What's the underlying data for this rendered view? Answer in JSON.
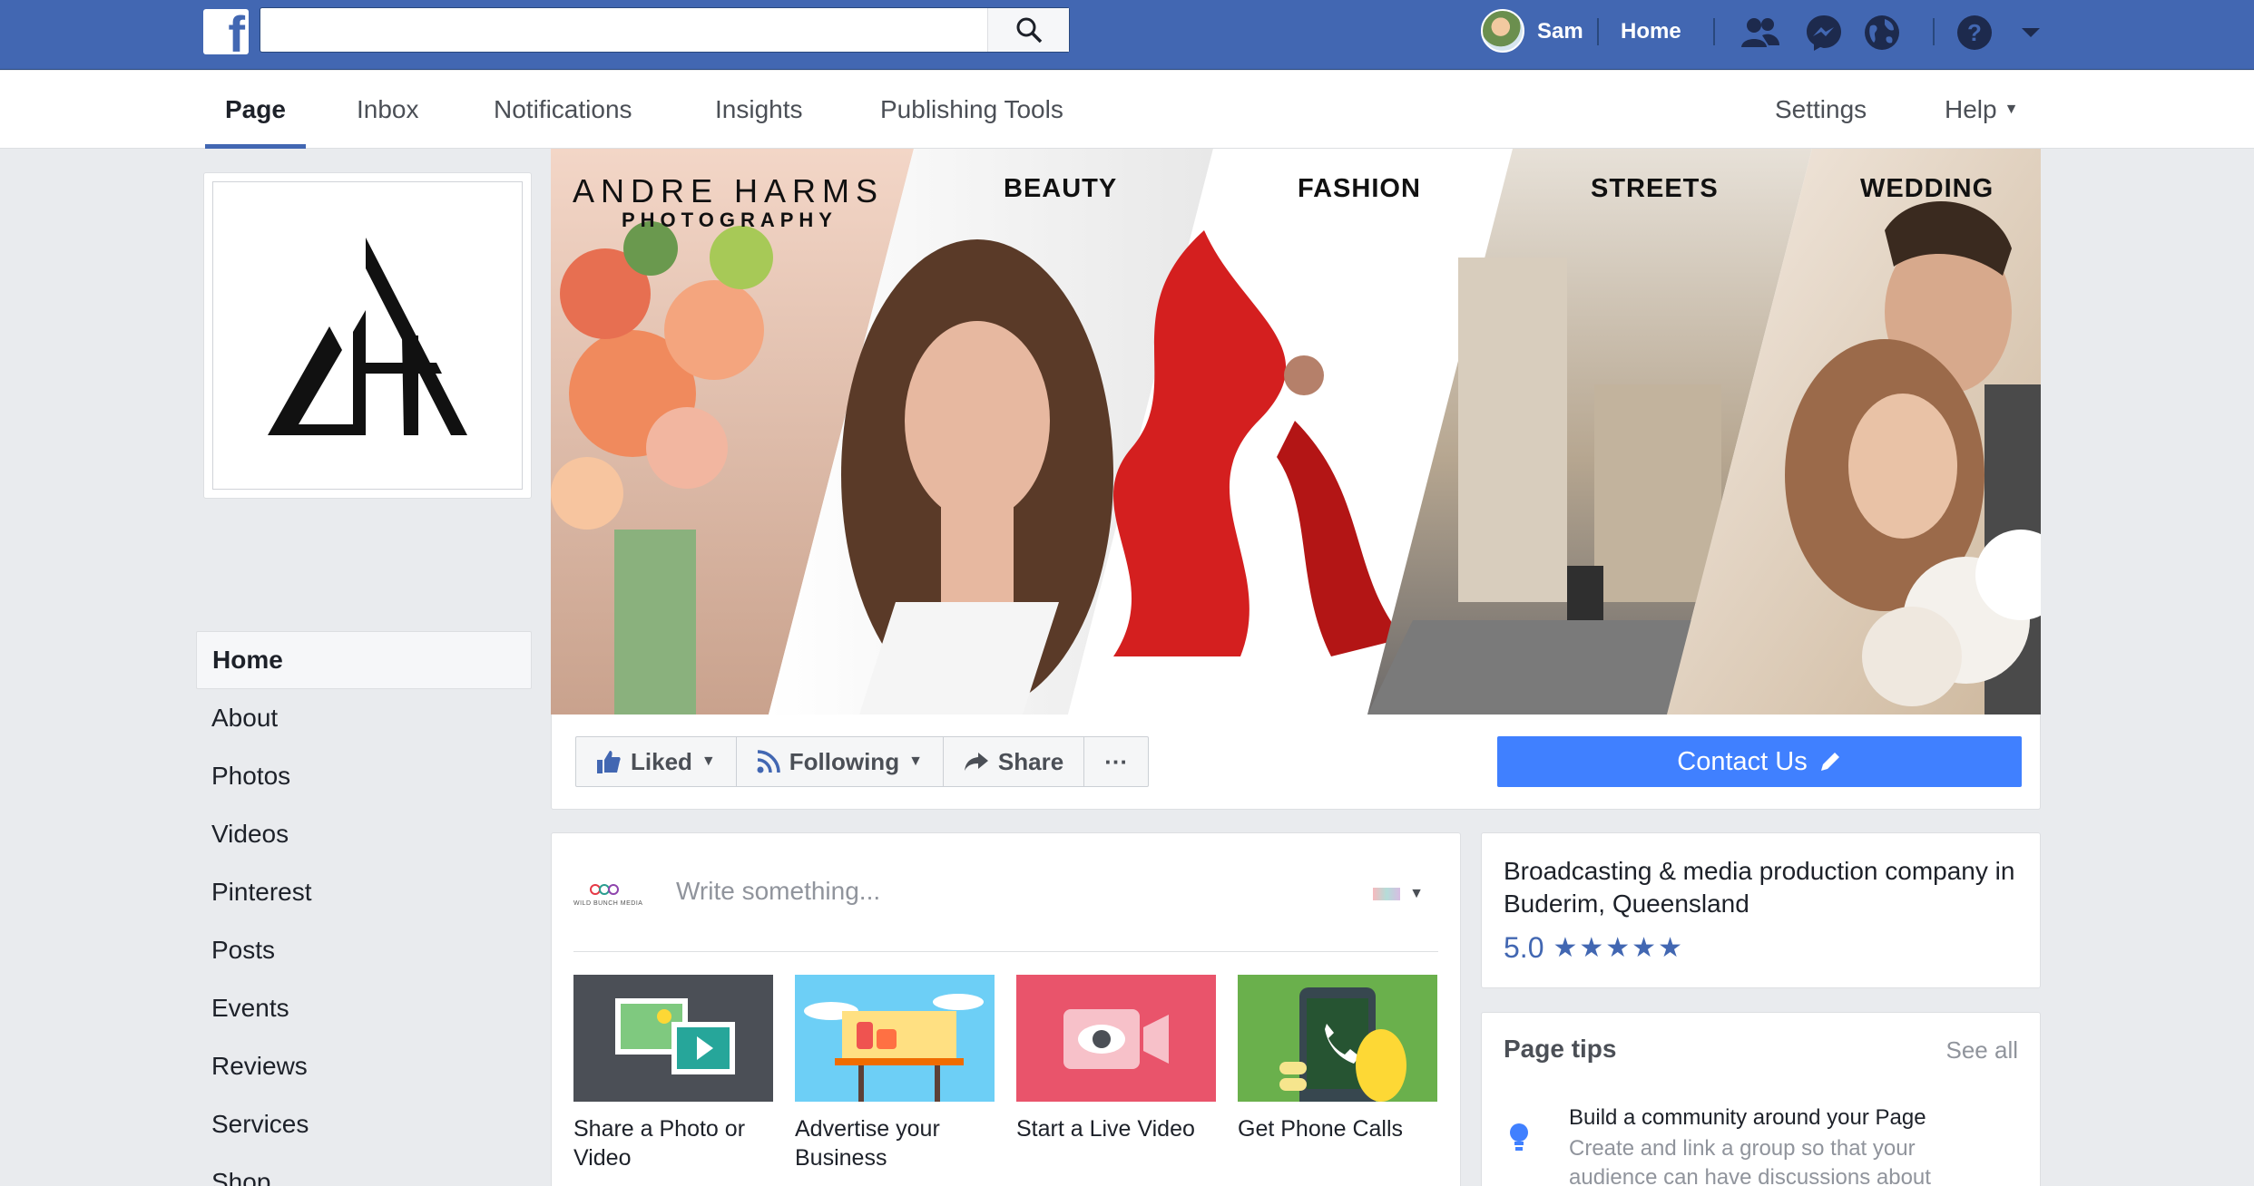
{
  "topbar": {
    "logo": "f",
    "search_placeholder": "",
    "user_name": "Sam",
    "home_label": "Home",
    "icons": [
      "friends-icon",
      "messenger-icon",
      "globe-icon",
      "help-icon",
      "caret-down-icon"
    ]
  },
  "subnav": {
    "tabs": [
      {
        "label": "Page",
        "active": true
      },
      {
        "label": "Inbox"
      },
      {
        "label": "Notifications"
      },
      {
        "label": "Insights"
      },
      {
        "label": "Publishing Tools"
      }
    ],
    "settings_label": "Settings",
    "help_label": "Help"
  },
  "leftnav": {
    "items": [
      "Home",
      "About",
      "Photos",
      "Videos",
      "Pinterest",
      "Posts",
      "Events",
      "Reviews",
      "Services",
      "Shop"
    ]
  },
  "cover": {
    "brand_title": "ANDRE HARMS",
    "brand_sub": "PHOTOGRAPHY",
    "labels": [
      "BEAUTY",
      "FASHION",
      "STREETS",
      "WEDDING"
    ]
  },
  "actions": {
    "liked": "Liked",
    "following": "Following",
    "share": "Share",
    "more": "···",
    "contact": "Contact Us"
  },
  "composer": {
    "avatar_label": "WILD BUNCH MEDIA",
    "placeholder": "Write something...",
    "tiles": [
      {
        "label": "Share a Photo or Video",
        "color": "#4b4f56"
      },
      {
        "label": "Advertise your Business",
        "color": "#6dcff6"
      },
      {
        "label": "Start a Live Video",
        "color": "#e9546b"
      },
      {
        "label": "Get Phone Calls",
        "color": "#6ab04c"
      }
    ]
  },
  "about": {
    "description": "Broadcasting & media production company in Buderim, Queensland",
    "rating": "5.0",
    "stars": "★★★★★"
  },
  "tips": {
    "title": "Page tips",
    "see_all": "See all",
    "tip_title": "Build a community around your Page",
    "tip_desc": "Create and link a group so that your audience can have discussions about"
  },
  "colors": {
    "fb_blue": "#4267b2",
    "contact_blue": "#4080ff",
    "page_bg": "#e9ebee"
  }
}
